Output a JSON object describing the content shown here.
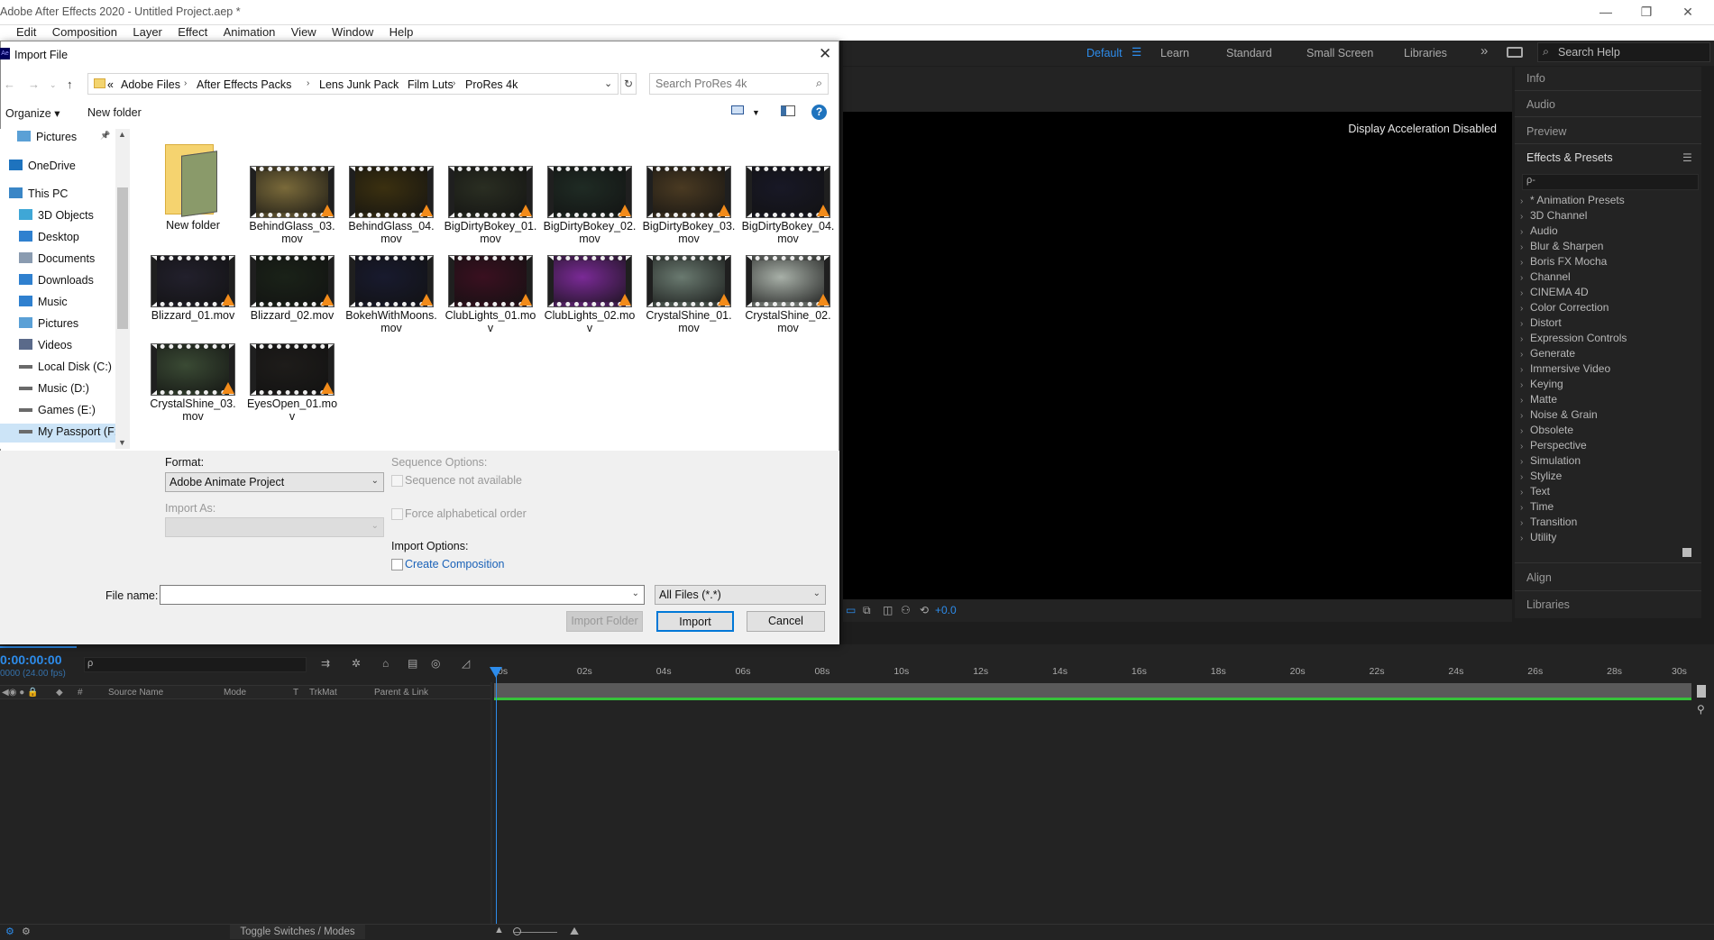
{
  "app": {
    "title": "Adobe After Effects 2020 - Untitled Project.aep *",
    "menu": [
      "Edit",
      "Composition",
      "Layer",
      "Effect",
      "Animation",
      "View",
      "Window",
      "Help"
    ],
    "window_controls": {
      "minimize": "—",
      "restore": "❐",
      "close": "✕"
    }
  },
  "workspace": {
    "items": [
      "Default",
      "Learn",
      "Standard",
      "Small Screen",
      "Libraries"
    ],
    "active": "Default",
    "more": "»",
    "search_help": "Search Help"
  },
  "viewer": {
    "message": "Display Acceleration Disabled",
    "exposure": "+0.0"
  },
  "right_panel": {
    "panels_top": [
      "Info",
      "Audio",
      "Preview"
    ],
    "effects_title": "Effects & Presets",
    "effects_search_placeholder": "ρ-",
    "effects": [
      "* Animation Presets",
      "3D Channel",
      "Audio",
      "Blur & Sharpen",
      "Boris FX Mocha",
      "Channel",
      "CINEMA 4D",
      "Color Correction",
      "Distort",
      "Expression Controls",
      "Generate",
      "Immersive Video",
      "Keying",
      "Matte",
      "Noise & Grain",
      "Obsolete",
      "Perspective",
      "Simulation",
      "Stylize",
      "Text",
      "Time",
      "Transition",
      "Utility"
    ],
    "panels_bottom": [
      "Align",
      "Libraries"
    ]
  },
  "timeline": {
    "timecode": "0:00:00:00",
    "fps": "0000 (24.00 fps)",
    "columns": [
      "Source Name",
      "Mode",
      "T",
      "TrkMat",
      "Parent & Link"
    ],
    "ruler": [
      "0s",
      "02s",
      "04s",
      "06s",
      "08s",
      "10s",
      "12s",
      "14s",
      "16s",
      "18s",
      "20s",
      "22s",
      "24s",
      "26s",
      "28s",
      "30s"
    ],
    "toggle_label": "Toggle Switches / Modes"
  },
  "dialog": {
    "title": "Import File",
    "icon": "Ae",
    "breadcrumb": [
      "Adobe Files",
      "After Effects Packs",
      "Lens Junk Pack",
      "Film Luts",
      "ProRes 4k"
    ],
    "breadcrumb_prefix": "«",
    "search_placeholder": "Search ProRes 4k",
    "organize": "Organize ▾",
    "new_folder": "New folder",
    "nav": [
      {
        "label": "Pictures",
        "icon": "pictures-icon",
        "pinned": true
      },
      {
        "label": "OneDrive",
        "icon": "onedrive-icon"
      },
      {
        "label": "This PC",
        "icon": "pc-icon"
      },
      {
        "label": "3D Objects",
        "icon": "3d-objects-icon"
      },
      {
        "label": "Desktop",
        "icon": "desktop-icon"
      },
      {
        "label": "Documents",
        "icon": "documents-icon"
      },
      {
        "label": "Downloads",
        "icon": "downloads-icon"
      },
      {
        "label": "Music",
        "icon": "music-icon"
      },
      {
        "label": "Pictures",
        "icon": "pictures-icon"
      },
      {
        "label": "Videos",
        "icon": "videos-icon"
      },
      {
        "label": "Local Disk (C:)",
        "icon": "drive-icon"
      },
      {
        "label": "Music (D:)",
        "icon": "drive-icon"
      },
      {
        "label": "Games (E:)",
        "icon": "drive-icon"
      },
      {
        "label": "My Passport (F:)",
        "icon": "drive-icon",
        "selected": true
      }
    ],
    "files": [
      {
        "name": "New folder",
        "type": "folder"
      },
      {
        "name": "BehindGlass_03.mov",
        "color": "#7a6a3a"
      },
      {
        "name": "BehindGlass_04.mov",
        "color": "#3b3010"
      },
      {
        "name": "BigDirtyBokey_01.mov",
        "color": "#2a2e22"
      },
      {
        "name": "BigDirtyBokey_02.mov",
        "color": "#1f2b24"
      },
      {
        "name": "BigDirtyBokey_03.mov",
        "color": "#4a3a22"
      },
      {
        "name": "BigDirtyBokey_04.mov",
        "color": "#181826"
      },
      {
        "name": "Blizzard_01.mov",
        "color": "#22202c"
      },
      {
        "name": "Blizzard_02.mov",
        "color": "#1a2218"
      },
      {
        "name": "BokehWithMoons.mov",
        "color": "#181a2e"
      },
      {
        "name": "ClubLights_01.mov",
        "color": "#3a1020"
      },
      {
        "name": "ClubLights_02.mov",
        "color": "#7a2a96"
      },
      {
        "name": "CrystalShine_01.mov",
        "color": "#6a7a70"
      },
      {
        "name": "CrystalShine_02.mov",
        "color": "#a8b0a8"
      },
      {
        "name": "CrystalShine_03.mov",
        "color": "#3a4a34"
      },
      {
        "name": "EyesOpen_01.mov",
        "color": "#1e1c1a"
      }
    ],
    "format_label": "Format:",
    "format_value": "Adobe Animate Project",
    "import_as_label": "Import As:",
    "sequence_options_label": "Sequence Options:",
    "sequence_not_available": "Sequence not available",
    "force_alpha": "Force alphabetical order",
    "import_options_label": "Import Options:",
    "create_composition": "Create Composition",
    "file_name_label": "File name:",
    "file_type": "All Files (*.*)",
    "import_folder": "Import Folder",
    "import": "Import",
    "cancel": "Cancel"
  }
}
